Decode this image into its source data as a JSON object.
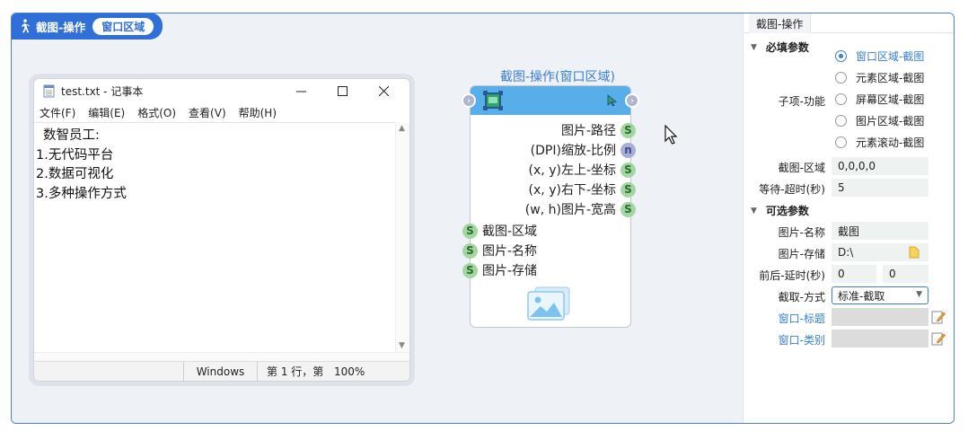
{
  "header": {
    "title": "截图-操作",
    "pill": "窗口区域"
  },
  "notepad": {
    "title": "test.txt - 记事本",
    "menu": [
      "文件(F)",
      "编辑(E)",
      "格式(O)",
      "查看(V)",
      "帮助(H)"
    ],
    "lines": [
      "数智员工:",
      "1.无代码平台",
      "2.数据可视化",
      "3.多种操作方式"
    ],
    "status": {
      "encoding": "Windows",
      "position": "第 1 行，第",
      "zoom": "100%"
    }
  },
  "node": {
    "title": "截图-操作(窗口区域)",
    "outputs": [
      {
        "label": "图片-路径",
        "type": "S"
      },
      {
        "label": "(DPI)缩放-比例",
        "type": "n"
      },
      {
        "label": "(x, y)左上-坐标",
        "type": "S"
      },
      {
        "label": "(x, y)右下-坐标",
        "type": "S"
      },
      {
        "label": "(w, h)图片-宽高",
        "type": "S"
      }
    ],
    "inputs": [
      {
        "label": "截图-区域",
        "type": "S"
      },
      {
        "label": "图片-名称",
        "type": "S"
      },
      {
        "label": "图片-存储",
        "type": "S"
      }
    ]
  },
  "panel": {
    "tab": "截图-操作",
    "required_section": "必填参数",
    "optional_section": "可选参数",
    "function_label": "子项-功能",
    "options": [
      "窗口区域-截图",
      "元素区域-截图",
      "屏幕区域-截图",
      "图片区域-截图",
      "元素滚动-截图"
    ],
    "selected_option": "窗口区域-截图",
    "region_label": "截图-区域",
    "region_value": "0,0,0,0",
    "timeout_label": "等待-超时(秒)",
    "timeout_value": "5",
    "name_label": "图片-名称",
    "name_value": "截图",
    "store_label": "图片-存储",
    "store_value": "D:\\",
    "delay_label": "前后-延时(秒)",
    "delay_before": "0",
    "delay_after": "0",
    "mode_label": "截取-方式",
    "mode_value": "标准-截取",
    "win_title_label": "窗口-标题",
    "win_class_label": "窗口-类别"
  },
  "colors": {
    "accent": "#2f6fd7",
    "node_head": "#58aee8",
    "port_s": "#a3d6a3",
    "port_n": "#a9aed6"
  }
}
